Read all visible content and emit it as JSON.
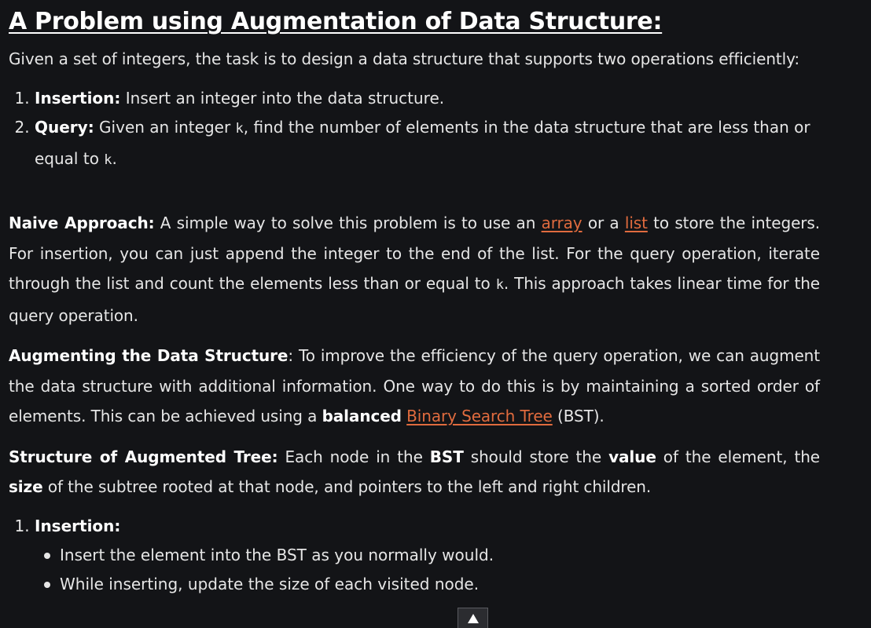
{
  "article": {
    "title": "A Problem using Augmentation of Data Structure:",
    "intro": "Given a set of integers, the task is to design a data structure that supports two operations efficiently:",
    "ops": [
      {
        "label": "Insertion:",
        "text": " Insert an integer into the data structure."
      },
      {
        "label": "Query:",
        "text_a": " Given an integer ",
        "var": "k",
        "text_b": ", find the number of elements in the data structure that are less than or equal to ",
        "var2": "k",
        "text_c": "."
      }
    ],
    "naive": {
      "label": "Naive Approach:",
      "t1": " A simple way to solve this problem is to use an ",
      "link_array": "array",
      "t2": " or a ",
      "link_list": "list",
      "t3": " to store the integers. For insertion, you can just append the integer to the end of the list. For the query operation, iterate through the list and count the elements less than or equal to ",
      "var": "k",
      "t4": ". This approach takes linear time for the query operation."
    },
    "augment": {
      "label": "Augmenting the Data Structure",
      "t1": ": To improve the efficiency of the query operation, we can augment the data structure with additional information. One way to do this is by maintaining a sorted order of elements. This can be achieved using a ",
      "bold": "balanced",
      "t2": " ",
      "link_bst": "Binary Search Tree",
      "t3": " (BST)."
    },
    "structure": {
      "label": "Structure of Augmented Tree:",
      "t1": " Each node in the ",
      "b1": "BST",
      "t2": " should store the ",
      "b2": "value",
      "t3": " of the element, the ",
      "b3": "size",
      "t4": " of the subtree rooted at that node, and pointers to the left and right children."
    },
    "steps": [
      {
        "label": "Insertion:",
        "bullets": [
          "Insert the element into the BST as you normally would.",
          "While inserting, update the size of each visited node."
        ]
      }
    ]
  },
  "ui": {
    "scroll_top_icon": "arrow-up-icon"
  }
}
